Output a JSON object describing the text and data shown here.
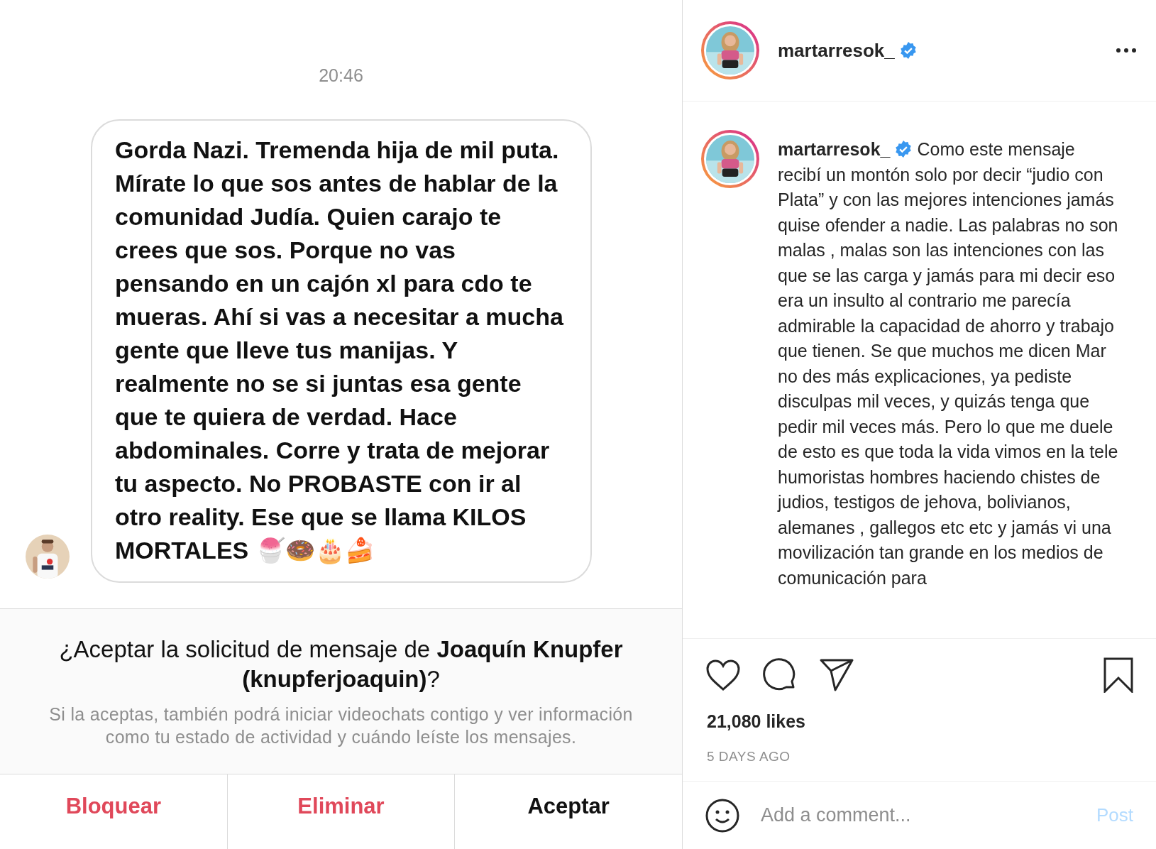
{
  "message_screenshot": {
    "time": "20:46",
    "message": "Gorda Nazi. Tremenda hija de mil puta. Mírate lo que sos antes de hablar de la comunidad Judía.  Quien carajo te crees que sos. Porque no vas pensando en un cajón xl para cdo te mueras. Ahí si vas a necesitar a mucha gente que lleve tus manijas. Y realmente no se si juntas esa gente que te quiera de verdad. Hace abdominales.  Corre y trata de mejorar tu aspecto.  No PROBASTE con  ir al otro reality. Ese que se llama KILOS MORTALES 🍧🍩🎂🍰",
    "request_title": "¿Aceptar la solicitud de mensaje de **Joaquín Knupfer (knupferjoaquin)**?",
    "request_description": "Si la aceptas, también podrá iniciar videochats contigo y ver información como tu estado de actividad y cuándo leíste los mensajes.",
    "actions": [
      {
        "label": "Bloquear",
        "kind": "danger"
      },
      {
        "label": "Eliminar",
        "kind": "danger"
      },
      {
        "label": "Aceptar",
        "kind": "normal"
      }
    ]
  },
  "post": {
    "username": "martarresok_",
    "verified": true,
    "caption_username": "martarresok_",
    "caption": "Como este mensaje recibí un montón solo por decir “judio con Plata” y con las mejores intenciones jamás quise ofender a nadie. Las palabras no son malas , malas son las intenciones con las que se las carga y jamás para mi decir eso era un insulto al contrario me parecía admirable la capacidad de ahorro y trabajo que tienen. Se que muchos me dicen Mar no des más explicaciones, ya pediste disculpas mil veces, y quizás tenga que pedir mil veces más. Pero lo que me duele de esto es que toda la vida vimos en la tele humoristas hombres haciendo chistes de judios, testigos de jehova, bolivianos, alemanes , gallegos etc etc y jamás vi una movilización tan grande en los medios de comunicación para",
    "liked": false,
    "saved": false,
    "likes": "21,080 likes",
    "age": "5 DAYS AGO",
    "comment_placeholder": "Add a comment...",
    "post_button": "Post"
  }
}
